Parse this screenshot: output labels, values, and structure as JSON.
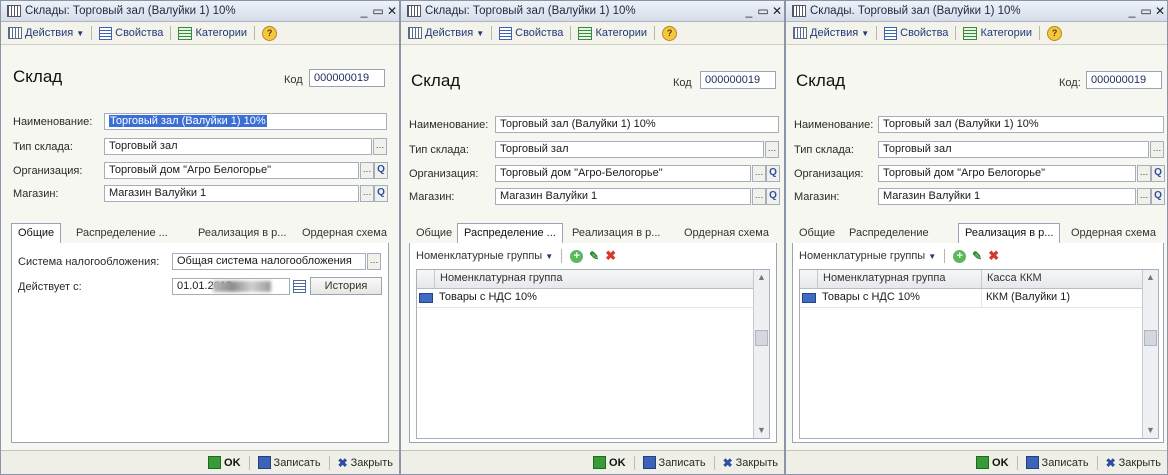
{
  "windows": [
    {
      "title": "Склады: Торговый зал (Валуйки 1) 10%",
      "toolbar": {
        "actions": "Действия",
        "properties": "Свойства",
        "categories": "Категории"
      },
      "heading": "Склад",
      "kod_label": "Код",
      "kod_value": "000000019",
      "fields": {
        "name_label": "Наименование:",
        "name_value": "Торговый зал (Валуйки 1) 10%",
        "type_label": "Тип склада:",
        "type_value": "Торговый зал",
        "org_label": "Организация:",
        "org_value": "Торговый дом \"Агро Белогорье\"",
        "shop_label": "Магазин:",
        "shop_value": "Магазин Валуйки 1"
      },
      "tabs": [
        "Общие",
        "Распределение ...",
        "Реализация в р...",
        "Ордерная схема"
      ],
      "active_tab": "Общие",
      "general": {
        "tax_label": "Система налогообложения:",
        "tax_value": "Общая система налогообложения",
        "valid_label": "Действует с:",
        "valid_value": "01.01.2018",
        "history_button": "История"
      },
      "footer": {
        "ok": "OK",
        "save": "Записать",
        "close": "Закрыть"
      }
    },
    {
      "title": "Склады: Торговый зал (Валуйки 1) 10%",
      "toolbar": {
        "actions": "Действия",
        "properties": "Свойства",
        "categories": "Категории"
      },
      "heading": "Склад",
      "kod_label": "Код",
      "kod_value": "000000019",
      "fields": {
        "name_label": "Наименование:",
        "name_value": "Торговый зал (Валуйки 1) 10%",
        "type_label": "Тип склада:",
        "type_value": "Торговый зал",
        "org_label": "Организация:",
        "org_value": "Торговый дом \"Агро-Белогорье\"",
        "shop_label": "Магазин:",
        "shop_value": "Магазин Валуйки 1"
      },
      "tabs": [
        "Общие",
        "Распределение ...",
        "Реализация в р...",
        "Ордерная схема"
      ],
      "active_tab": "Распределение ...",
      "subbar_label": "Номенклатурные группы",
      "grid": {
        "columns": [
          "Номенклатурная группа"
        ],
        "rows": [
          [
            "Товары с НДС 10%"
          ]
        ]
      },
      "footer": {
        "ok": "OK",
        "save": "Записать",
        "close": "Закрыть"
      }
    },
    {
      "title": "Склады. Торговый зал (Валуйки 1) 10%",
      "toolbar": {
        "actions": "Действия",
        "properties": "Свойства",
        "categories": "Категории"
      },
      "heading": "Склад",
      "kod_label": "Код:",
      "kod_value": "000000019",
      "fields": {
        "name_label": "Наименование:",
        "name_value": "Торговый зал (Валуйки 1) 10%",
        "type_label": "Тип склада:",
        "type_value": "Торговый зал",
        "org_label": "Организация:",
        "org_value": "Торговый дом \"Агро Белогорье\"",
        "shop_label": "Магазин:",
        "shop_value": "Магазин Валуйки 1"
      },
      "tabs": [
        "Общие",
        "Распределение",
        "Реализация в р...",
        "Ордерная схема"
      ],
      "active_tab": "Реализация в р...",
      "subbar_label": "Номенклатурные группы",
      "grid": {
        "columns": [
          "Номенклатурная группа",
          "Касса ККМ"
        ],
        "rows": [
          [
            "Товары с НДС 10%",
            "ККМ (Валуйки 1)"
          ]
        ]
      },
      "footer": {
        "ok": "OK",
        "save": "Записать",
        "close": "Закрыть"
      }
    }
  ],
  "colors": {
    "selection": "#3b6fd6",
    "titlebar": "#d6dde8",
    "accent": "#1f3a78"
  }
}
